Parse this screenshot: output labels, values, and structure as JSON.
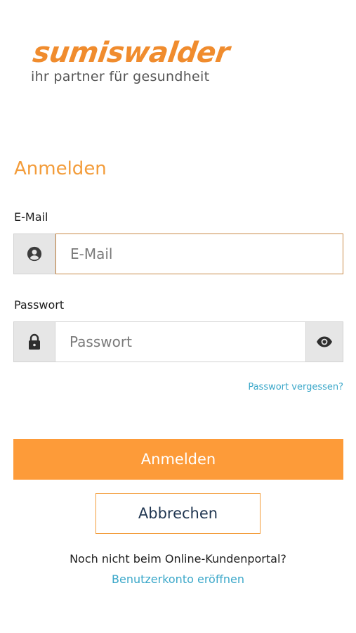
{
  "logo": {
    "wordmark": "sumiswalder",
    "tagline": "ihr partner für gesundheit"
  },
  "form": {
    "title": "Anmelden",
    "email": {
      "label": "E-Mail",
      "placeholder": "E-Mail",
      "value": "",
      "icon": "user-circle-icon"
    },
    "password": {
      "label": "Passwort",
      "placeholder": "Passwort",
      "value": "",
      "icon": "lock-icon",
      "toggle_icon": "eye-icon"
    },
    "forgot_password": "Passwort vergessen?",
    "submit_label": "Anmelden",
    "cancel_label": "Abbrechen"
  },
  "signup": {
    "prompt": "Noch nicht beim Online-Kundenportal?",
    "link": "Benutzerkonto eröffnen"
  },
  "colors": {
    "brand_orange": "#fd9b39",
    "title_orange": "#f39c3a",
    "link_blue": "#3aa7c9",
    "addon_gray": "#e6e6e6",
    "cancel_text": "#1f3550"
  }
}
